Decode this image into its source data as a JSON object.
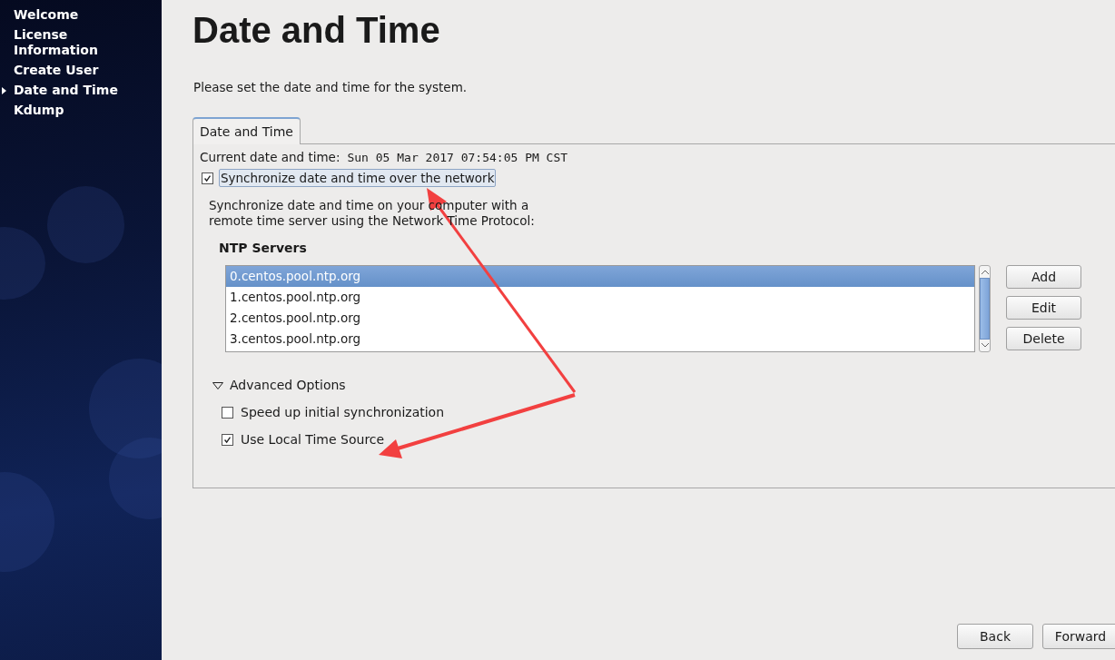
{
  "sidebar": {
    "items": [
      {
        "label": "Welcome",
        "selected": false
      },
      {
        "label": "License Information",
        "selected": false
      },
      {
        "label": "Create User",
        "selected": false
      },
      {
        "label": "Date and Time",
        "selected": true
      },
      {
        "label": "Kdump",
        "selected": false
      }
    ]
  },
  "page": {
    "title": "Date and Time",
    "subtitle": "Please set the date and time for the system."
  },
  "tabs": [
    {
      "label": "Date and Time",
      "selected": true
    }
  ],
  "current": {
    "label": "Current date and time:",
    "value": "Sun 05 Mar 2017 07:54:05 PM CST"
  },
  "sync": {
    "label": "Synchronize date and time over the network",
    "checked": true,
    "focused": true
  },
  "description": "Synchronize date and time on your computer with a remote time server using the Network Time Protocol:",
  "ntp": {
    "heading": "NTP Servers",
    "servers": [
      {
        "name": "0.centos.pool.ntp.org",
        "selected": true
      },
      {
        "name": "1.centos.pool.ntp.org",
        "selected": false
      },
      {
        "name": "2.centos.pool.ntp.org",
        "selected": false
      },
      {
        "name": "3.centos.pool.ntp.org",
        "selected": false
      }
    ],
    "buttons": [
      "Add",
      "Edit",
      "Delete"
    ]
  },
  "advanced": {
    "label": "Advanced Options",
    "expanded": true,
    "options": [
      {
        "label": "Speed up initial synchronization",
        "checked": false
      },
      {
        "label": "Use Local Time Source",
        "checked": true
      }
    ]
  },
  "footer": {
    "buttons": [
      "Back",
      "Forward"
    ]
  }
}
